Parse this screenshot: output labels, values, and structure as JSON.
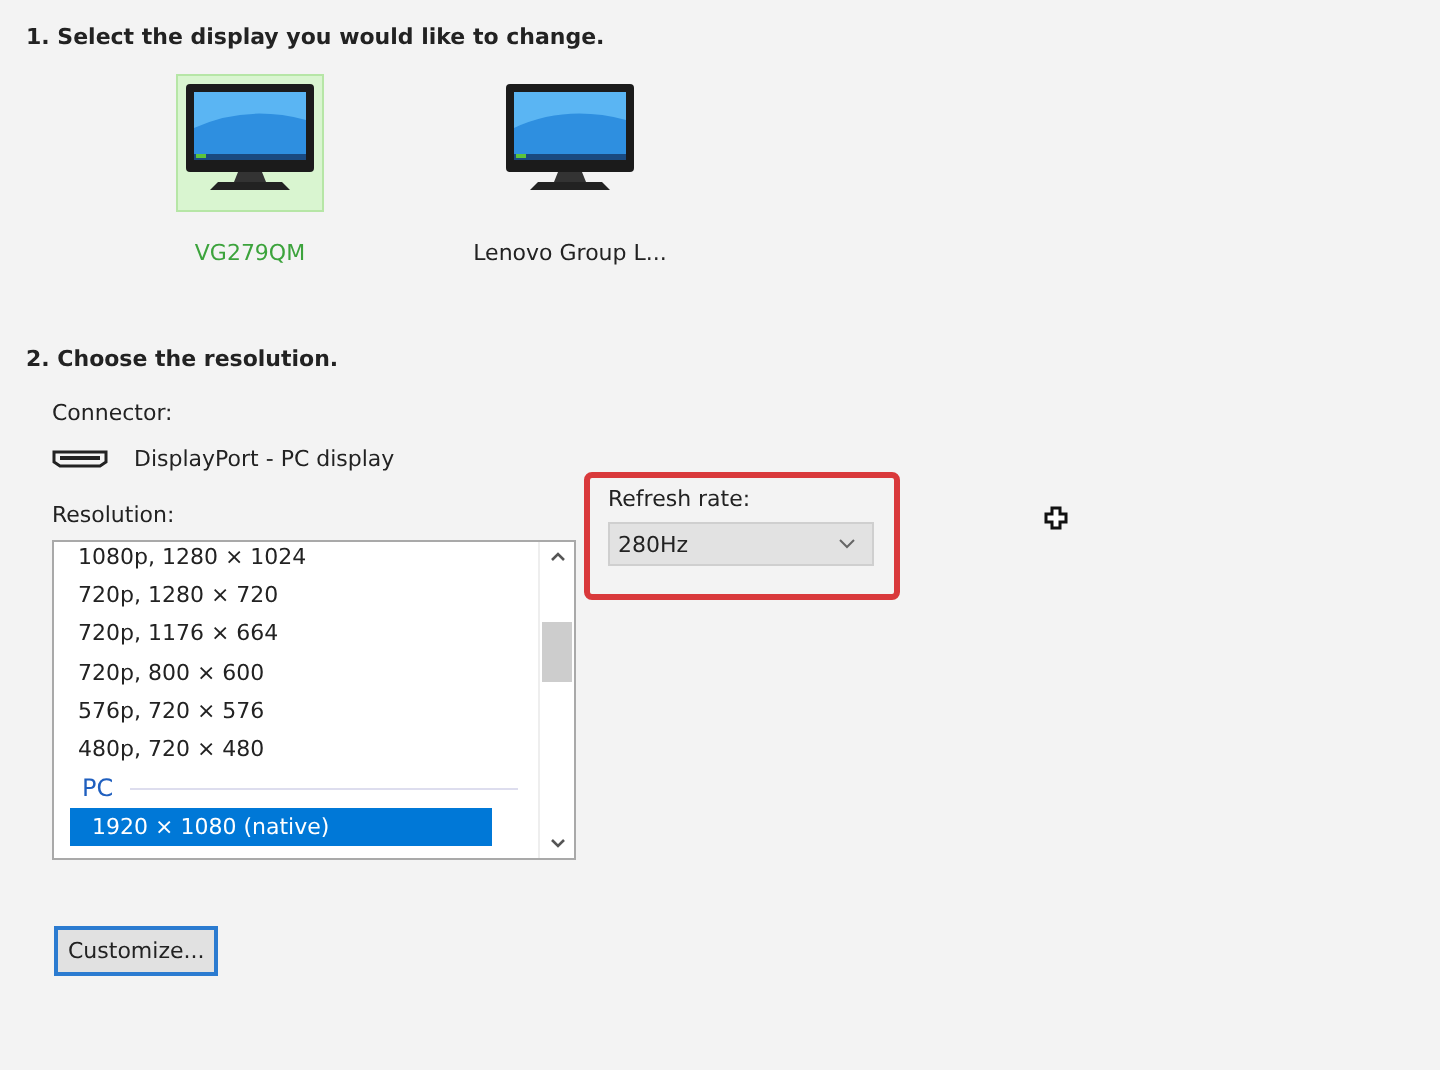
{
  "step1": {
    "heading": "1. Select the display you would like to change."
  },
  "displays": [
    {
      "label": "VG279QM",
      "selected": true
    },
    {
      "label": "Lenovo Group L...",
      "selected": false
    }
  ],
  "step2": {
    "heading": "2. Choose the resolution."
  },
  "connector": {
    "label": "Connector:",
    "value": "DisplayPort - PC display"
  },
  "resolution": {
    "label": "Resolution:",
    "items": [
      {
        "kind": "option",
        "text": "1080p, 1280 × 1024",
        "selected": false
      },
      {
        "kind": "option",
        "text": "720p, 1280 × 720",
        "selected": false
      },
      {
        "kind": "option",
        "text": "720p, 1176 × 664",
        "selected": false
      },
      {
        "kind": "option",
        "text": "720p, 800 × 600",
        "selected": false
      },
      {
        "kind": "option",
        "text": "576p, 720 × 576",
        "selected": false
      },
      {
        "kind": "option",
        "text": "480p, 720 × 480",
        "selected": false
      },
      {
        "kind": "group",
        "text": "PC"
      },
      {
        "kind": "option",
        "text": "1920 × 1080 (native)",
        "selected": true
      }
    ]
  },
  "refresh_rate": {
    "label": "Refresh rate:",
    "value": "280Hz"
  },
  "customize_button": "Customize..."
}
